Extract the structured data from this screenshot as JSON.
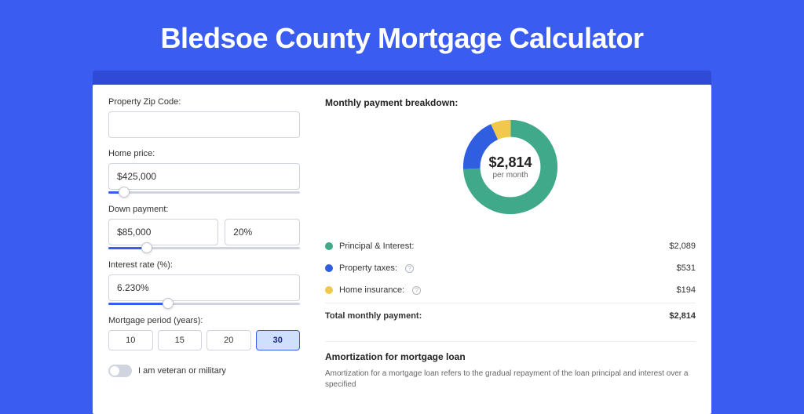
{
  "page": {
    "title": "Bledsoe County Mortgage Calculator"
  },
  "form": {
    "zip_label": "Property Zip Code:",
    "zip_value": "",
    "home_price_label": "Home price:",
    "home_price_value": "$425,000",
    "home_price_slider_pct": 8,
    "down_payment_label": "Down payment:",
    "down_payment_value": "$85,000",
    "down_payment_pct_value": "20%",
    "down_payment_slider_pct": 20,
    "interest_label": "Interest rate (%):",
    "interest_value": "6.230%",
    "interest_slider_pct": 31,
    "period_label": "Mortgage period (years):",
    "period_options": [
      "10",
      "15",
      "20",
      "30"
    ],
    "period_selected_index": 3,
    "veteran_label": "I am veteran or military"
  },
  "breakdown": {
    "title": "Monthly payment breakdown:",
    "donut_amount": "$2,814",
    "donut_sub": "per month",
    "principal_label": "Principal & Interest:",
    "principal_value": "$2,089",
    "taxes_label": "Property taxes:",
    "taxes_value": "$531",
    "insurance_label": "Home insurance:",
    "insurance_value": "$194",
    "total_label": "Total monthly payment:",
    "total_value": "$2,814"
  },
  "chart_data": {
    "type": "pie",
    "title": "Monthly payment breakdown:",
    "series": [
      {
        "name": "Principal & Interest",
        "value": 2089,
        "color": "#3fa98a"
      },
      {
        "name": "Property taxes",
        "value": 531,
        "color": "#2f5ee0"
      },
      {
        "name": "Home insurance",
        "value": 194,
        "color": "#f1c84b"
      }
    ],
    "total": 2814,
    "center_label": "$2,814",
    "center_sub": "per month"
  },
  "amortization": {
    "title": "Amortization for mortgage loan",
    "text": "Amortization for a mortgage loan refers to the gradual repayment of the loan principal and interest over a specified"
  }
}
